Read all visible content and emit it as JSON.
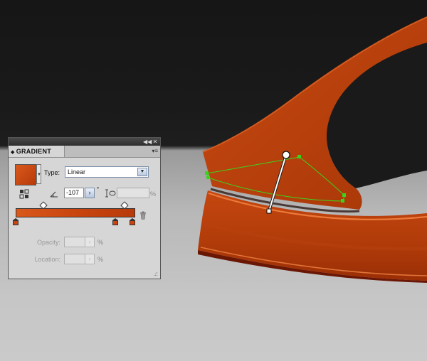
{
  "panel": {
    "tab_title": "GRADIENT",
    "tab_arrows": "◆",
    "collapse_glyph": "◀◀",
    "close_glyph": "✕",
    "menu_glyph": "▾≡",
    "type_label": "Type:",
    "type_value": "Linear",
    "select_arrow": "▼",
    "angle_value": "-107",
    "stepper_glyph": "›",
    "degree_symbol": "°",
    "aspect_pct": "%",
    "opacity_label": "Opacity:",
    "opacity_pct": "%",
    "location_label": "Location:",
    "location_pct": "%",
    "swatch_drop_glyph": "▼"
  },
  "gradient": {
    "start_color": "#d9581c",
    "end_color": "#b83a0a",
    "stops": [
      0.0,
      0.85,
      1.0
    ],
    "midpoints": [
      0.23,
      0.92
    ]
  },
  "canvas": {
    "shape_colors": [
      "#c74410",
      "#a83308",
      "#7a1a04",
      "#e86a2a"
    ],
    "path_highlight_color": "#2ecc1a",
    "gradient_annotator_color": "#ffffff"
  },
  "icons": [
    "reverse-gradient-icon",
    "angle-icon",
    "aspect-ratio-icon",
    "trash-icon",
    "resize-grip-icon"
  ]
}
